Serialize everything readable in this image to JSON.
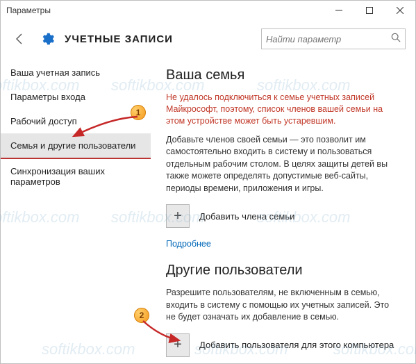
{
  "window": {
    "title": "Параметры"
  },
  "header": {
    "app_title": "УЧЕТНЫЕ ЗАПИСИ"
  },
  "search": {
    "placeholder": "Найти параметр"
  },
  "sidebar": {
    "items": [
      {
        "label": "Ваша учетная запись"
      },
      {
        "label": "Параметры входа"
      },
      {
        "label": "Рабочий доступ"
      },
      {
        "label": "Семья и другие пользователи"
      },
      {
        "label": "Синхронизация ваших параметров"
      }
    ],
    "selected_index": 3
  },
  "section1": {
    "heading": "Ваша семья",
    "error": "Не удалось подключиться к семье учетных записей Майкрософт, поэтому, список членов вашей семьи на этом устройстве может быть устаревшим.",
    "desc": "Добавьте членов своей семьи — это позволит им самостоятельно входить в систему и пользоваться отдельным рабочим столом. В целях защиты детей вы также можете определять допустимые веб-сайты, периоды времени, приложения и игры.",
    "add_label": "Добавить члена семьи",
    "link": "Подробнее"
  },
  "section2": {
    "heading": "Другие пользователи",
    "desc": "Разрешите пользователям, не включенным в семью, входить в систему с помощью их учетных записей. Это не будет означать их добавление в семью.",
    "add_label": "Добавить пользователя для этого компьютера"
  },
  "annotations": {
    "badge1": "1",
    "badge2": "2"
  },
  "watermark": "softikbox.com"
}
